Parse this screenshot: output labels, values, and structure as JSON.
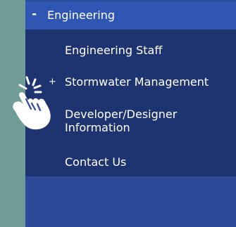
{
  "menu": {
    "header": {
      "toggle": "-",
      "label": "Engineering"
    },
    "items": [
      {
        "label": "Engineering Staff",
        "expand": ""
      },
      {
        "label": "Stormwater Management",
        "expand": "+"
      },
      {
        "label": "Developer/Designer Information",
        "expand": ""
      },
      {
        "label": "Contact Us",
        "expand": ""
      }
    ]
  },
  "icons": {
    "cursor": "hand-pointer-click-icon"
  },
  "colors": {
    "page_background": "#6f9c97",
    "panel_background": "#2d4a99",
    "header_background": "#2f56b3",
    "submenu_background": "#1e3470",
    "text": "#ffffff"
  }
}
